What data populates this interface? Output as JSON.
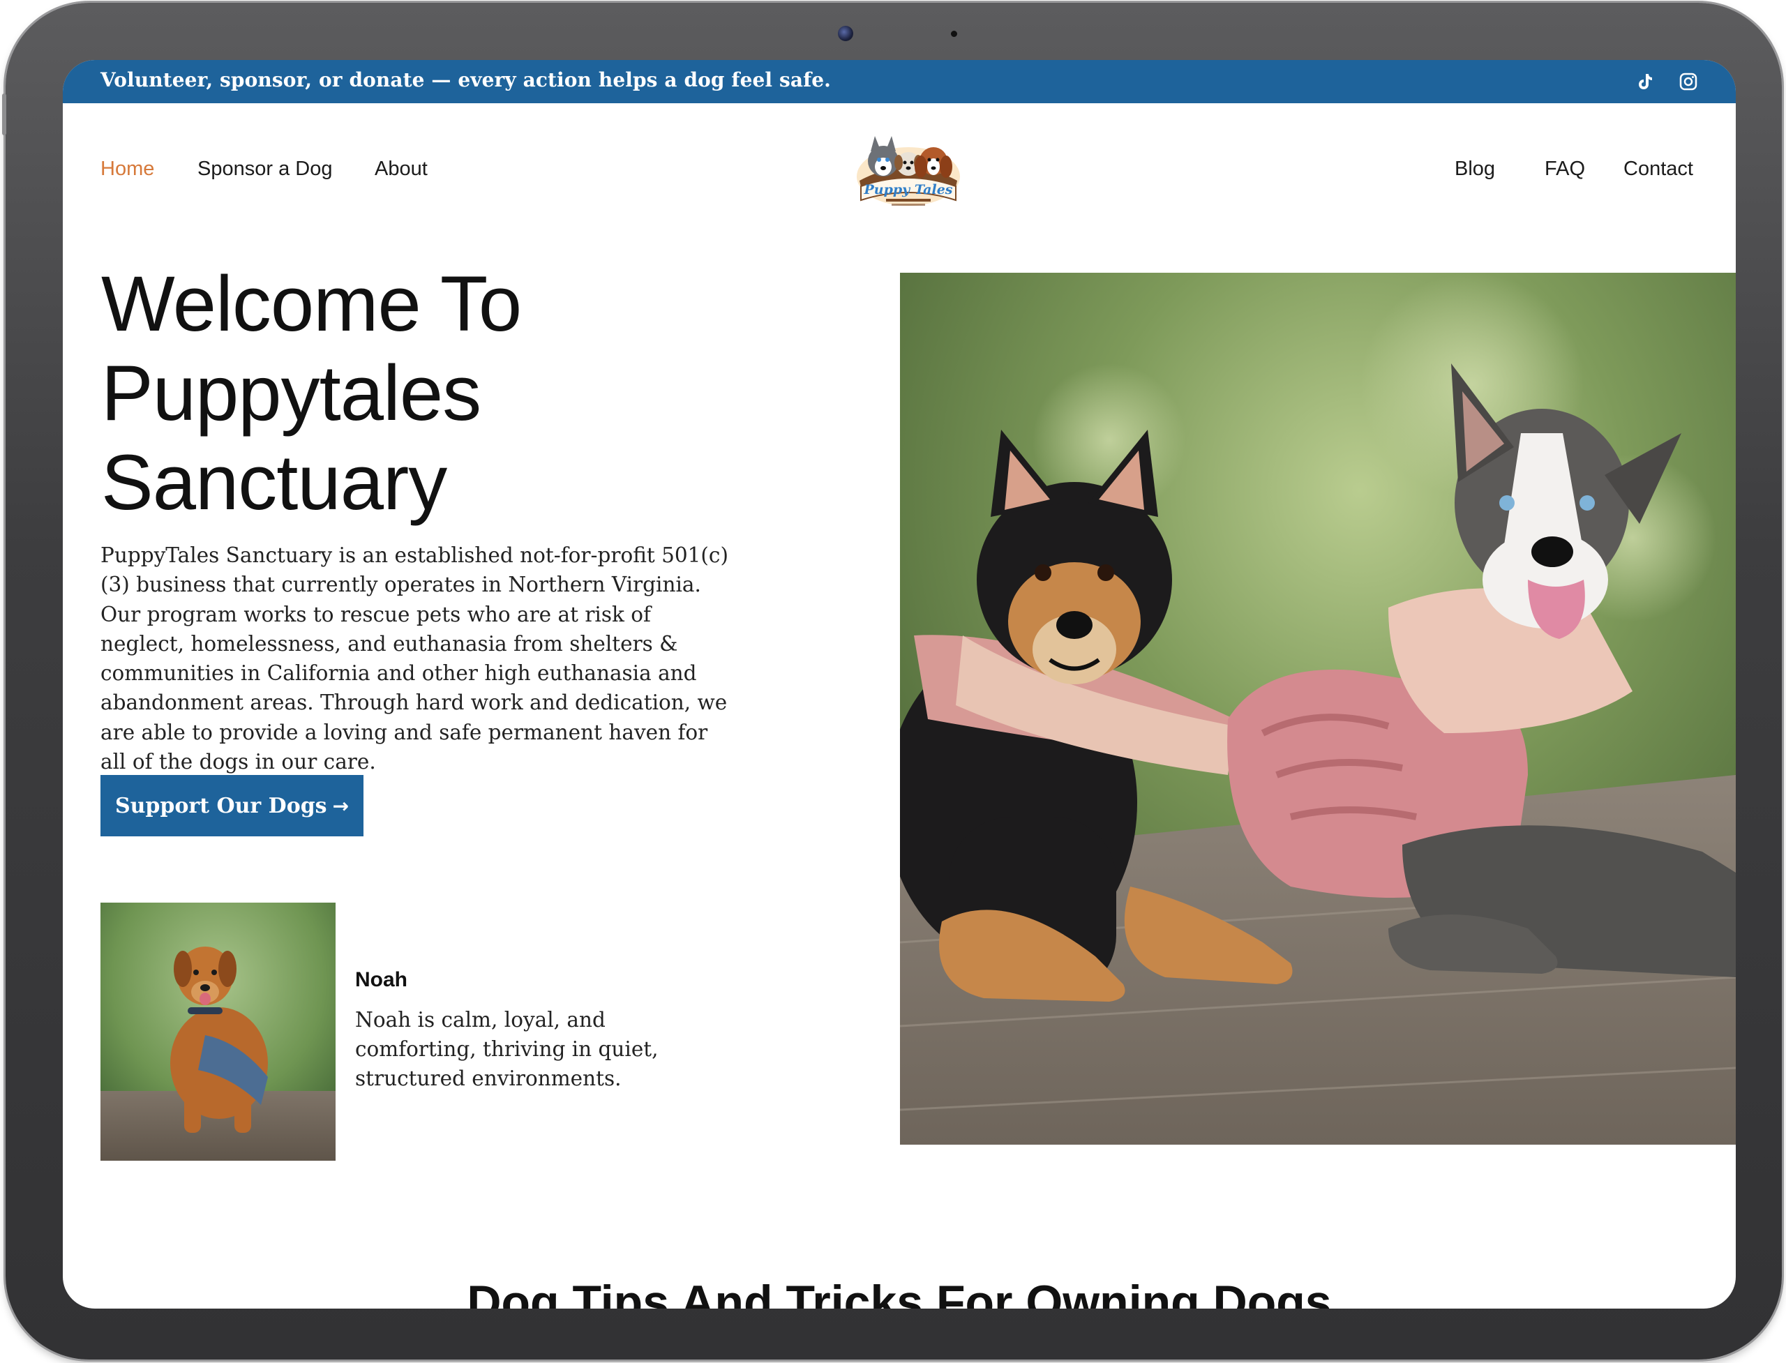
{
  "announcement": {
    "text": "Volunteer, sponsor, or donate — every action helps a dog feel safe.",
    "icons": [
      "tiktok-icon",
      "instagram-icon"
    ]
  },
  "nav": {
    "left": [
      {
        "label": "Home",
        "active": true
      },
      {
        "label": "Sponsor a Dog",
        "active": false
      },
      {
        "label": "About",
        "active": false
      }
    ],
    "right": [
      {
        "label": "Blog"
      },
      {
        "label": "FAQ"
      },
      {
        "label": "Contact"
      }
    ],
    "logo_text": "Puppy Tales"
  },
  "hero": {
    "title_lines": [
      "Welcome To",
      "Puppytales",
      "Sanctuary"
    ],
    "description": "PuppyTales Sanctuary is an established not-for-profit 501(c)(3) business that currently operates in Northern Virginia. Our program works to rescue pets who are at risk of neglect, homelessness, and euthanasia from shelters & communities in California and other high euthanasia and abandonment areas. Through hard work and dedication, we are able to provide a loving and safe permanent haven for all of the dogs in our care.",
    "cta_label": "Support Our Dogs",
    "cta_arrow": "→"
  },
  "featured_dog": {
    "name": "Noah",
    "description": "Noah is calm, loyal, and comforting, thriving in quiet, structured environments."
  },
  "section": {
    "title": "Dog Tips And Tricks For Owning Dogs"
  },
  "colors": {
    "brand_blue": "#1e639b",
    "active_nav": "#d6793a",
    "text": "#1b1b1b"
  }
}
